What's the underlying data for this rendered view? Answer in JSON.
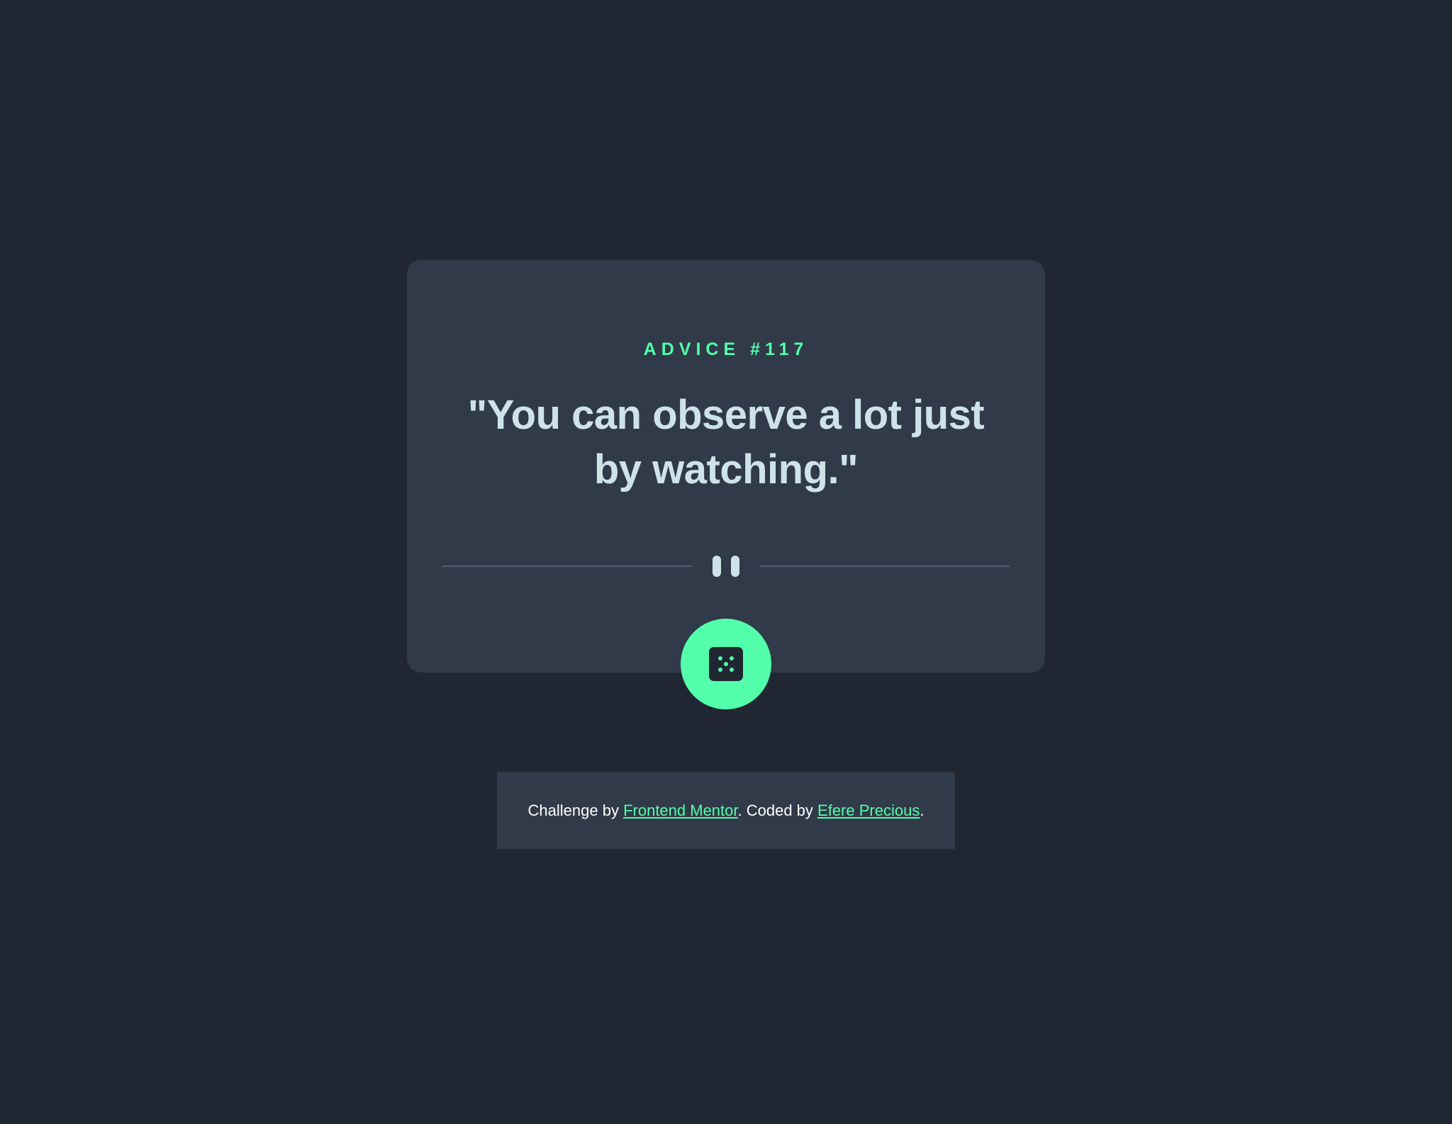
{
  "card": {
    "advice_label": "ADVICE #117",
    "quote": "\"You can observe a lot just by watching.\""
  },
  "divider": {
    "icon": "pause-icon"
  },
  "dice_button": {
    "icon": "dice-icon"
  },
  "attribution": {
    "prefix": "Challenge by ",
    "link1": "Frontend Mentor",
    "middle": ". Coded by ",
    "link2": "Efere Precious",
    "suffix": "."
  },
  "colors": {
    "background": "#202733",
    "card": "#313a48",
    "accent": "#53ffaa",
    "quote_text": "#cee3e9",
    "divider": "#4f5d74"
  }
}
